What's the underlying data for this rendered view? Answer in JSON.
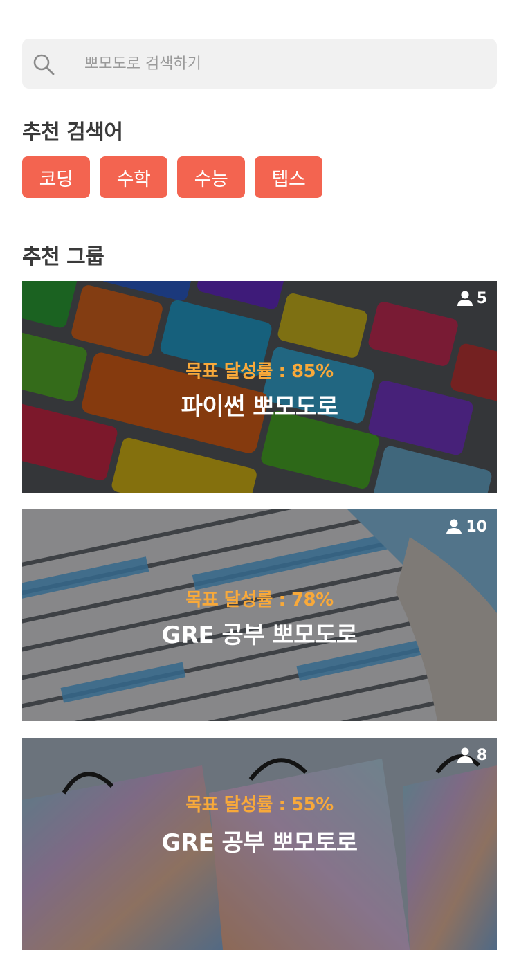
{
  "search": {
    "placeholder": "뽀모도로 검색하기",
    "icon": "search-icon"
  },
  "recommended_keywords": {
    "title": "추천 검색어",
    "chips": [
      "코딩",
      "수학",
      "수능",
      "텝스"
    ],
    "chip_color": "#f36450"
  },
  "recommended_groups": {
    "title": "추천 그룹",
    "rate_color": "#f8a93a",
    "cards": [
      {
        "members": "5",
        "rate": "목표 달성률 : 85%",
        "title": "파이썬 뽀모도로"
      },
      {
        "members": "10",
        "rate": "목표 달성률 : 78%",
        "title": "GRE 공부 뽀모도로"
      },
      {
        "members": "8",
        "rate": "목표 달성률 : 55%",
        "title": "GRE 공부 뽀모토로"
      }
    ]
  }
}
